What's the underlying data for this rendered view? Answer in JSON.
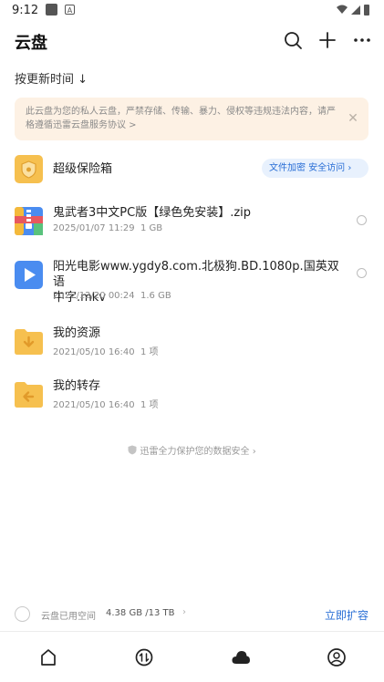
{
  "status_bar": {
    "time": "9:12",
    "badge": "A"
  },
  "header": {
    "title": "云盘",
    "icons": [
      "search-icon",
      "plus-icon",
      "more-icon"
    ]
  },
  "sort": {
    "label": "按更新时间",
    "arrow": "↓"
  },
  "notice": {
    "text": "此云盘为您的私人云盘，严禁存储、传输、暴力、侵权等违规违法内容，请严格遵循",
    "link": "迅雷云盘服务协议",
    "link_suffix": " >",
    "close": "✕"
  },
  "vault": {
    "name": "超级保险箱",
    "pill": "文件加密 安全访问",
    "pill_arrow": "›"
  },
  "files": [
    {
      "name": "鬼武者3中文PC版【绿色免安装】.zip",
      "date": "2025/01/07 11:29",
      "size": "1 GB",
      "icon": "zip-icon"
    },
    {
      "name": "阳光电影www.ygdy8.com.北极狗.BD.1080p.国英双语中字.mkv",
      "name_line1": "阳光电影www.ygdy8.com.北极狗.BD.1080p.国英双语",
      "name_line2": "中字.mkv",
      "date": "2022/12/20 00:24",
      "size": "1.6 GB",
      "icon": "video-icon"
    },
    {
      "name": "我的资源",
      "date": "2021/05/10 16:40",
      "size": "1 项",
      "icon": "folder-download-icon"
    },
    {
      "name": "我的转存",
      "date": "2021/05/10 16:40",
      "size": "1 项",
      "icon": "folder-transfer-icon"
    }
  ],
  "protect_text": "迅雷全力保护您的数据安全",
  "protect_arrow": "›",
  "storage": {
    "label": "云盘已用空间",
    "used": "4.38 GB /13 TB",
    "arrow": "›",
    "expand": "立即扩容"
  },
  "tabs": [
    "home-icon",
    "transfer-icon",
    "cloud-icon",
    "profile-icon"
  ],
  "colors": {
    "accent": "#2a6fd6",
    "notice_bg": "#fdf1e4",
    "folder": "#f6c04f"
  }
}
